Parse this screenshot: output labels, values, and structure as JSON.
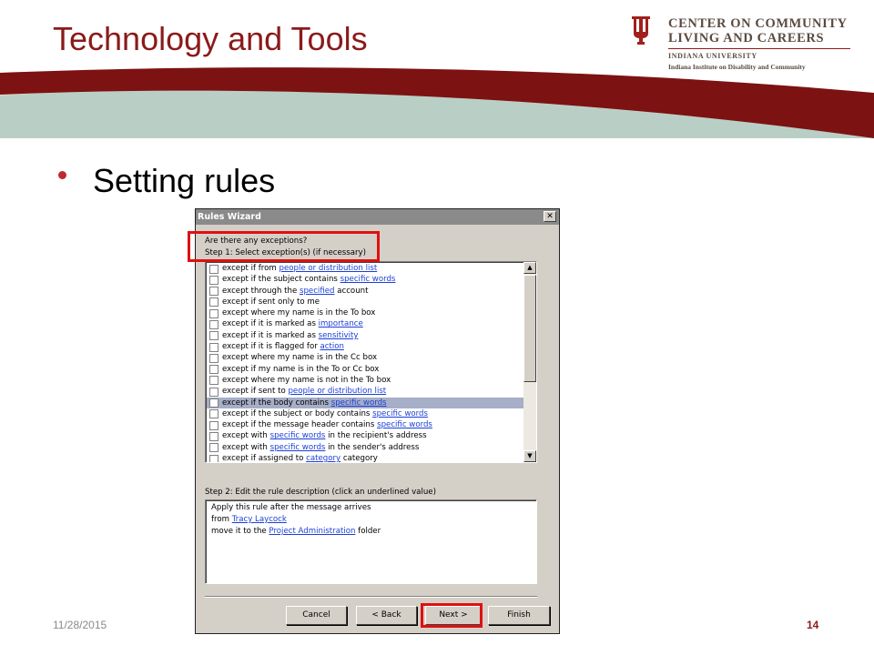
{
  "slide": {
    "title": "Technology and Tools",
    "bullet": "Setting rules",
    "date": "11/28/2015",
    "page_number": "14",
    "colors": {
      "brand": "#8b1a1a",
      "band_green": "#b9cfc6",
      "band_tan": "#d9cfb8"
    }
  },
  "logo": {
    "line1": "CENTER ON COMMUNITY",
    "line2": "LIVING AND CAREERS",
    "line3": "INDIANA UNIVERSITY",
    "line4": "Indiana Institute on Disability and Community"
  },
  "window": {
    "title": "Rules Wizard",
    "close_label": "✕",
    "question": "Are there any exceptions?",
    "step1_label": "Step 1: Select exception(s) (if necessary)",
    "exceptions": [
      {
        "pre": "except if from ",
        "link": "people or distribution list",
        "post": ""
      },
      {
        "pre": "except if the subject contains ",
        "link": "specific words",
        "post": ""
      },
      {
        "pre": "except through the ",
        "link": "specified",
        "post": " account"
      },
      {
        "pre": "except if sent only to me",
        "link": "",
        "post": ""
      },
      {
        "pre": "except where my name is in the To box",
        "link": "",
        "post": ""
      },
      {
        "pre": "except if it is marked as ",
        "link": "importance",
        "post": ""
      },
      {
        "pre": "except if it is marked as ",
        "link": "sensitivity",
        "post": ""
      },
      {
        "pre": "except if it is flagged for ",
        "link": "action",
        "post": ""
      },
      {
        "pre": "except where my name is in the Cc box",
        "link": "",
        "post": ""
      },
      {
        "pre": "except if my name is in the To or Cc box",
        "link": "",
        "post": ""
      },
      {
        "pre": "except where my name is not in the To box",
        "link": "",
        "post": ""
      },
      {
        "pre": "except if sent to ",
        "link": "people or distribution list",
        "post": ""
      },
      {
        "pre": "except if the body contains ",
        "link": "specific words",
        "post": "",
        "selected": true
      },
      {
        "pre": "except if the subject or body contains ",
        "link": "specific words",
        "post": ""
      },
      {
        "pre": "except if the message header contains ",
        "link": "specific words",
        "post": ""
      },
      {
        "pre": "except with ",
        "link": "specific words",
        "post": " in the recipient's address"
      },
      {
        "pre": "except with ",
        "link": "specific words",
        "post": " in the sender's address"
      },
      {
        "pre": "except if assigned to ",
        "link": "category",
        "post": " category"
      }
    ],
    "step2_label": "Step 2: Edit the rule description (click an underlined value)",
    "description": {
      "line1": "Apply this rule after the message arrives",
      "line2_pre": "from ",
      "line2_link": "Tracy Laycock",
      "line3_pre": "move it to the ",
      "line3_link": "Project Administration",
      "line3_post": " folder"
    },
    "buttons": {
      "cancel": "Cancel",
      "back": "< Back",
      "next": "Next >",
      "finish": "Finish"
    }
  }
}
